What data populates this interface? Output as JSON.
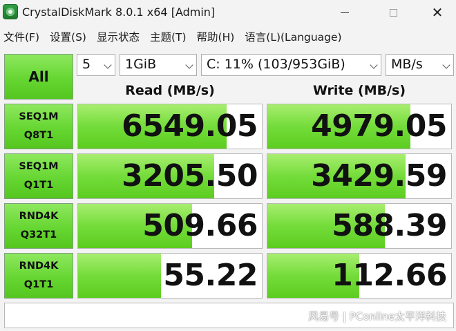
{
  "window": {
    "title": "CrystalDiskMark 8.0.1 x64 [Admin]",
    "icon": "crystaldiskmark-icon"
  },
  "menu": [
    {
      "label": "文件(F)"
    },
    {
      "label": "设置(S)"
    },
    {
      "label": "显示状态"
    },
    {
      "label": "主题(T)"
    },
    {
      "label": "帮助(H)"
    },
    {
      "label": "语言(L)(Language)"
    }
  ],
  "controls": {
    "all_label": "All",
    "count": "5",
    "size": "1GiB",
    "drive": "C: 11% (103/953GiB)",
    "unit": "MB/s"
  },
  "headers": {
    "read": "Read (MB/s)",
    "write": "Write (MB/s)"
  },
  "tests": [
    {
      "line1": "SEQ1M",
      "line2": "Q8T1",
      "read": "6549.05",
      "write": "4979.05",
      "read_fill": 0.81,
      "write_fill": 0.78
    },
    {
      "line1": "SEQ1M",
      "line2": "Q1T1",
      "read": "3205.50",
      "write": "3429.59",
      "read_fill": 0.74,
      "write_fill": 0.75
    },
    {
      "line1": "RND4K",
      "line2": "Q32T1",
      "read": "509.66",
      "write": "588.39",
      "read_fill": 0.62,
      "write_fill": 0.64
    },
    {
      "line1": "RND4K",
      "line2": "Q1T1",
      "read": "55.22",
      "write": "112.66",
      "read_fill": 0.45,
      "write_fill": 0.5
    }
  ],
  "comment": "",
  "watermark": "风易号 | PConline太平洋科技",
  "colors": {
    "accent_green": "#66d632",
    "bar_green": "#74dc3a"
  }
}
